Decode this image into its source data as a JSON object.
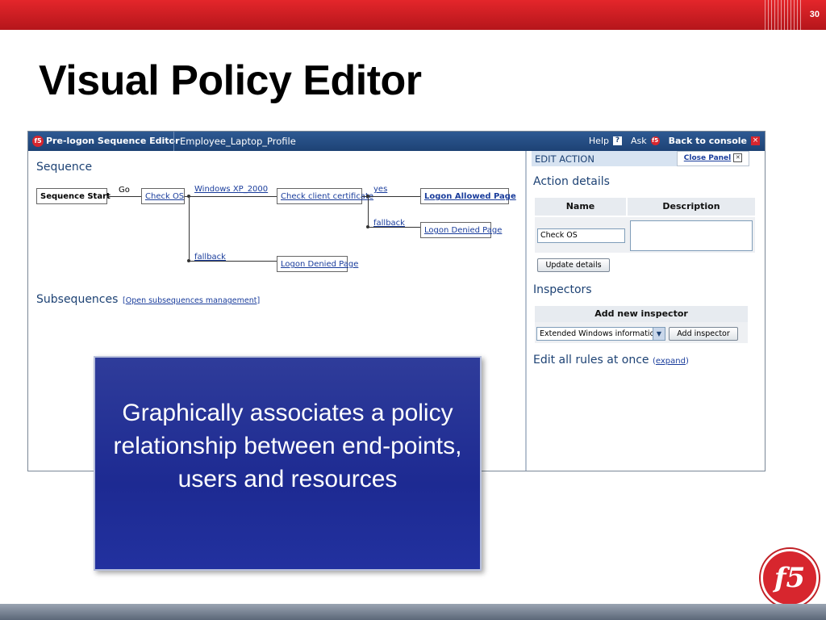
{
  "slide": {
    "number": "30",
    "title": "Visual Policy Editor",
    "callout": "Graphically associates a policy relationship between end-points, users and resources",
    "logo": "f5"
  },
  "app": {
    "header": {
      "logo": "f5",
      "title": "Pre-logon Sequence Editor",
      "profile": "Employee_Laptop_Profile",
      "help": "Help",
      "help_icon": "?",
      "ask": "Ask",
      "ask_icon": "f5",
      "back": "Back to console",
      "back_icon": "×"
    },
    "sequence": {
      "heading": "Sequence",
      "start": "Sequence Start",
      "go": "Go",
      "check_os": "Check OS",
      "windows": "Windows XP_2000",
      "check_cert": "Check client certificate",
      "yes": "yes",
      "allowed": "Logon Allowed Page",
      "fallback": "fallback",
      "denied": "Logon Denied Page"
    },
    "subsequences": {
      "heading": "Subsequences",
      "link": "Open subsequences management"
    },
    "edit_panel": {
      "title": "EDIT ACTION",
      "close_panel": "Close Panel",
      "action_details": "Action details",
      "col_name": "Name",
      "col_description": "Description",
      "name_value": "Check OS",
      "update_button": "Update details",
      "inspectors": "Inspectors",
      "add_new_inspector": "Add new inspector",
      "inspector_select": "Extended Windows information",
      "add_inspector_button": "Add inspector",
      "edit_rules": "Edit all rules at once",
      "expand": "expand"
    }
  }
}
